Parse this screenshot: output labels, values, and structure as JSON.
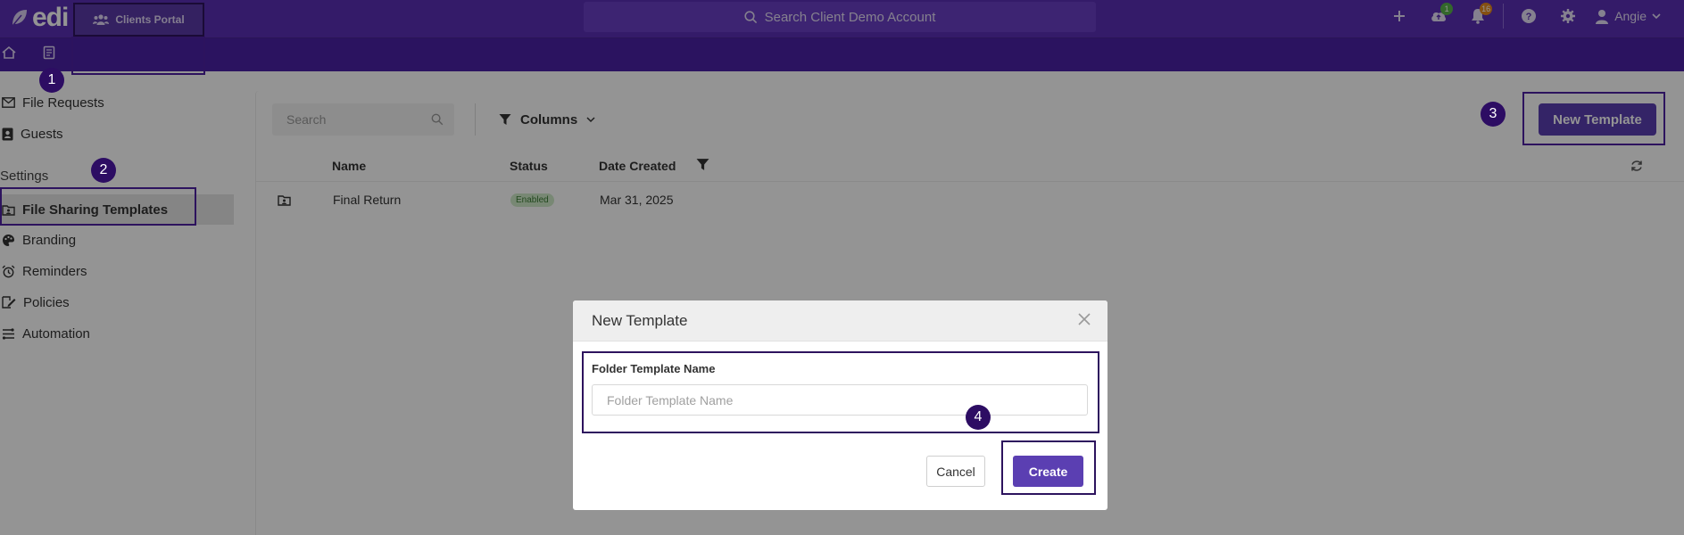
{
  "app": {
    "logo_text": "edi",
    "search_placeholder": "Search Client Demo Account",
    "badges": {
      "uploads": "1",
      "notifications": "16"
    },
    "user_name": "Angie"
  },
  "subnav": {
    "portal_label": "Clients Portal"
  },
  "sidebar": {
    "items_top": [
      {
        "label": "File Requests"
      },
      {
        "label": "Guests"
      }
    ],
    "settings_heading": "Settings",
    "items_settings": [
      {
        "label": "File Sharing Templates"
      },
      {
        "label": "Branding"
      },
      {
        "label": "Reminders"
      },
      {
        "label": "Policies"
      },
      {
        "label": "Automation"
      }
    ]
  },
  "main": {
    "search_placeholder": "Search",
    "columns_label": "Columns",
    "new_template_label": "New Template",
    "table": {
      "headers": [
        "Name",
        "Status",
        "Date Created"
      ],
      "rows": [
        {
          "name": "Final Return",
          "status": "Enabled",
          "date": "Mar 31, 2025"
        }
      ]
    }
  },
  "modal": {
    "title": "New Template",
    "field_label": "Folder Template Name",
    "field_placeholder": "Folder Template Name",
    "field_value": "",
    "cancel_label": "Cancel",
    "create_label": "Create"
  },
  "callouts": [
    "1",
    "2",
    "3",
    "4"
  ],
  "colors": {
    "brand": "#5b2fb5",
    "subnav": "#4b22a6",
    "primary_button": "#5b3fb2",
    "callout": "#2d0d63",
    "enabled_badge": "#cfeac8"
  },
  "icons": {
    "logo": "leaf-icon",
    "search": "search-icon",
    "plus": "plus-icon",
    "upload": "cloud-upload-icon",
    "bell": "bell-icon",
    "help": "question-circle-icon",
    "settings": "gear-icon",
    "user": "user-icon",
    "home": "home-icon",
    "doc": "document-icon",
    "users": "users-icon",
    "filter": "filter-icon",
    "refresh": "refresh-icon",
    "folder": "folder-icon",
    "close": "close-icon"
  }
}
